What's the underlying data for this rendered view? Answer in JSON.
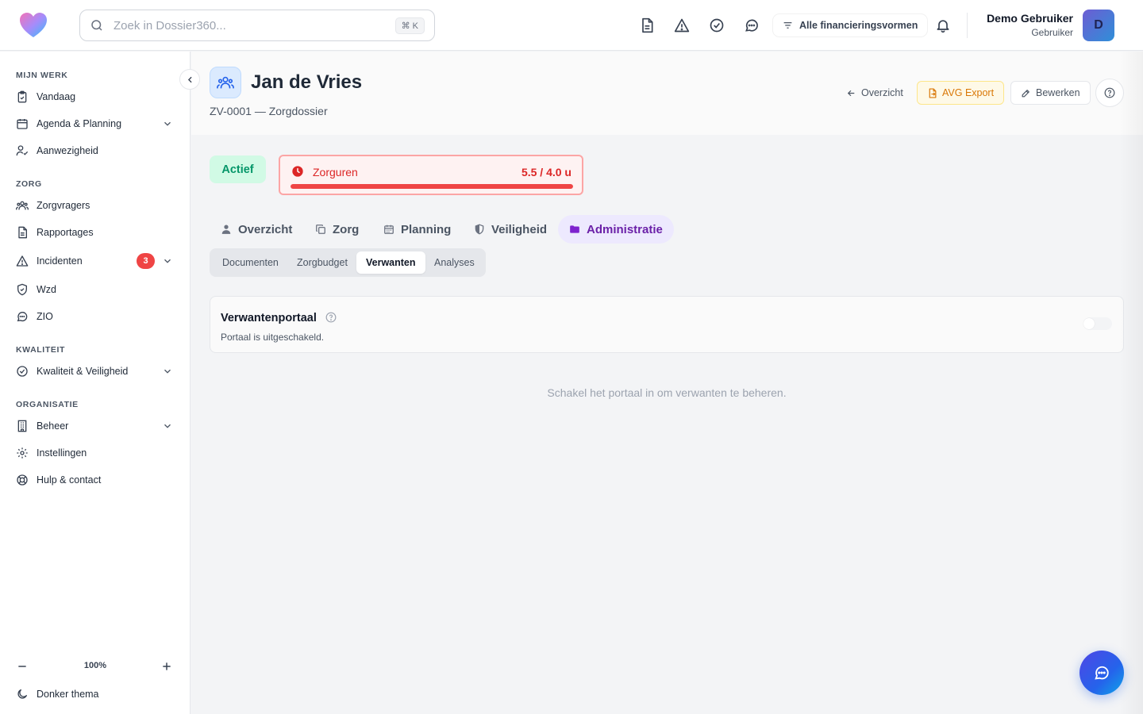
{
  "search": {
    "placeholder": "Zoek in Dossier360...",
    "shortcut": "⌘ K"
  },
  "header": {
    "filter_label": "Alle financieringsvormen",
    "user_name": "Demo Gebruiker",
    "user_role": "Gebruiker",
    "avatar_initial": "D",
    "icons": [
      "document-icon",
      "warning-icon",
      "check-circle-icon",
      "chat-icon",
      "filter-icon",
      "bell-icon"
    ]
  },
  "sidebar": {
    "sections": [
      {
        "title": "MIJN WERK",
        "items": [
          {
            "label": "Vandaag",
            "icon": "clipboard-check-icon"
          },
          {
            "label": "Agenda & Planning",
            "icon": "calendar-icon",
            "expandable": true
          },
          {
            "label": "Aanwezigheid",
            "icon": "user-check-icon"
          }
        ]
      },
      {
        "title": "ZORG",
        "items": [
          {
            "label": "Zorgvragers",
            "icon": "users-icon"
          },
          {
            "label": "Rapportages",
            "icon": "document-icon"
          },
          {
            "label": "Incidenten",
            "icon": "warning-icon",
            "badge": "3",
            "expandable": true
          },
          {
            "label": "Wzd",
            "icon": "shield-icon"
          },
          {
            "label": "ZIO",
            "icon": "chat-icon"
          }
        ]
      },
      {
        "title": "KWALITEIT",
        "items": [
          {
            "label": "Kwaliteit & Veiligheid",
            "icon": "check-circle-icon",
            "expandable": true
          }
        ]
      },
      {
        "title": "ORGANISATIE",
        "items": [
          {
            "label": "Beheer",
            "icon": "building-icon",
            "expandable": true
          },
          {
            "label": "Instellingen",
            "icon": "gear-icon"
          },
          {
            "label": "Hulp & contact",
            "icon": "lifebuoy-icon"
          }
        ]
      }
    ],
    "zoom": "100%",
    "theme_label": "Donker thema"
  },
  "client": {
    "name": "Jan de Vries",
    "subtitle": "ZV-0001 — Zorgdossier",
    "actions": {
      "overview": "Overzicht",
      "avg_export": "AVG Export",
      "edit": "Bewerken"
    },
    "status": "Actief",
    "hours": {
      "label": "Zorguren",
      "value_text": "5.5 / 4.0 u",
      "used": 5.5,
      "budget": 4.0
    }
  },
  "tabs": [
    {
      "label": "Overzicht",
      "icon": "user-icon"
    },
    {
      "label": "Zorg",
      "icon": "copy-icon"
    },
    {
      "label": "Planning",
      "icon": "calendar-icon"
    },
    {
      "label": "Veiligheid",
      "icon": "shield-icon"
    },
    {
      "label": "Administratie",
      "icon": "folder-icon",
      "active": true
    }
  ],
  "subtabs": [
    {
      "label": "Documenten"
    },
    {
      "label": "Zorgbudget"
    },
    {
      "label": "Verwanten",
      "active": true
    },
    {
      "label": "Analyses"
    }
  ],
  "portal": {
    "title": "Verwantenportaal",
    "description": "Portaal is uitgeschakeld.",
    "enabled": false,
    "empty_message": "Schakel het portaal in om verwanten te beheren."
  },
  "colors": {
    "accent": "#7e22ce",
    "danger": "#ef4444",
    "success": "#059669",
    "warning": "#d97706"
  }
}
